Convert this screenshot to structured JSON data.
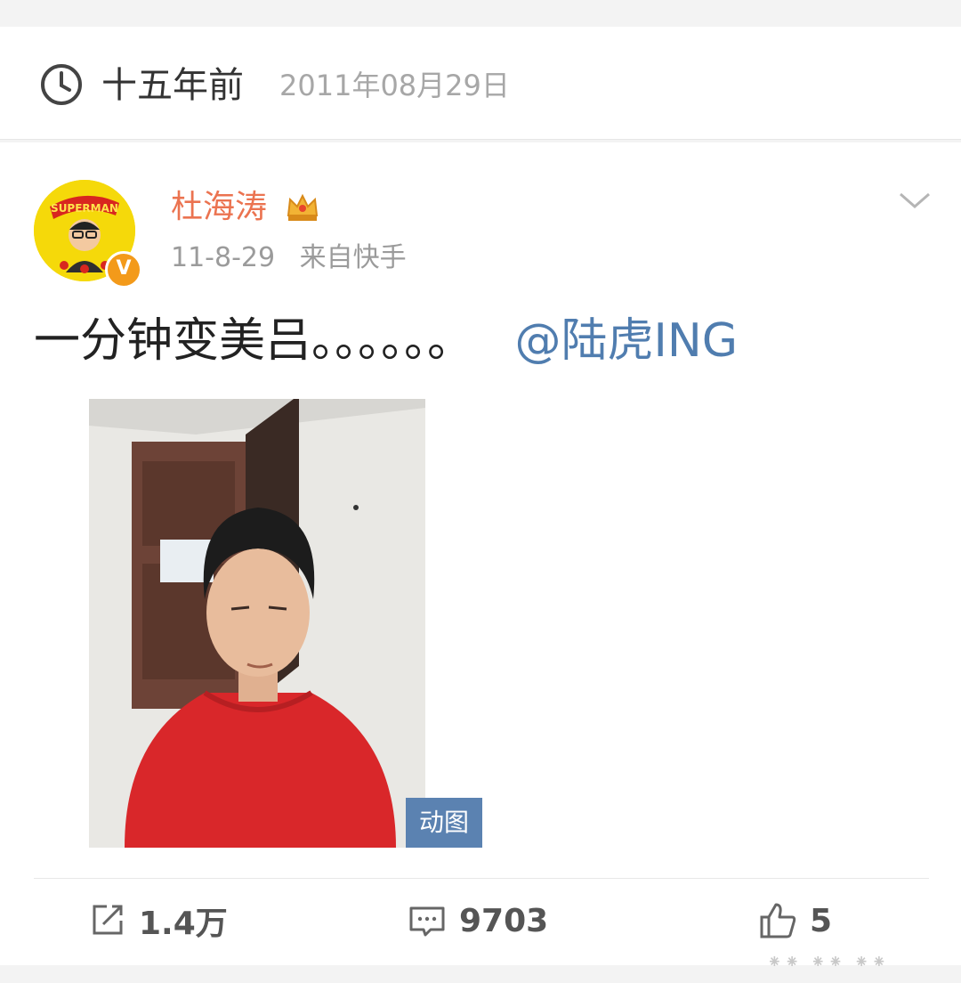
{
  "header": {
    "time_ago": "十五年前",
    "date": "2011年08月29日",
    "icon": "clock-icon"
  },
  "post": {
    "username": "杜海涛",
    "badge_icon": "crown-icon",
    "avatar_text": "SUPERMAN",
    "verified_mark": "V",
    "timestamp": "11-8-29",
    "source": "来自快手",
    "text": "一分钟变美吕。。。。。。",
    "mention": "@陆虎ING",
    "media_badge": "动图"
  },
  "actions": {
    "repost_count": "1.4万",
    "comment_count": "9703",
    "like_count": "5"
  },
  "colors": {
    "username": "#eb7350",
    "mention": "#507daf",
    "gif_badge": "#5b82b1",
    "verified": "#f39a1a"
  }
}
